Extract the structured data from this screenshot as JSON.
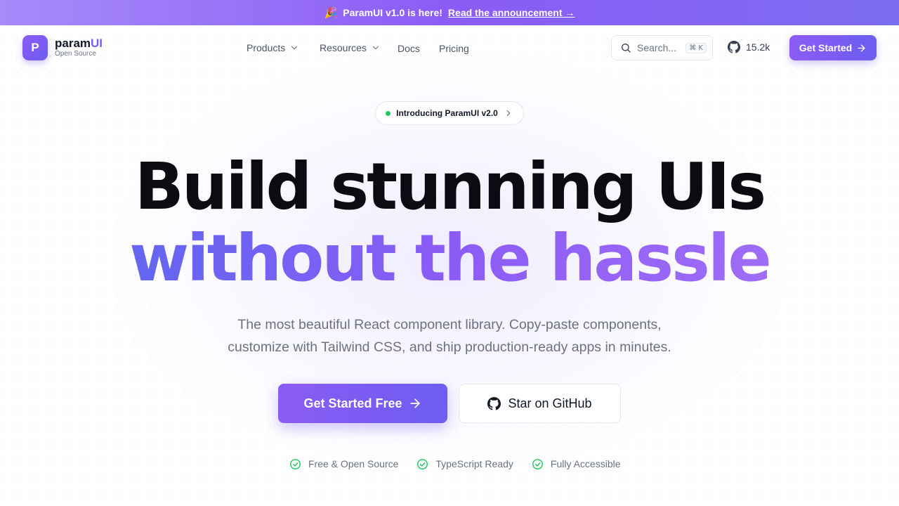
{
  "announcement": {
    "emoji": "🎉",
    "text": "ParamUI v1.0 is here!",
    "link": "Read the announcement →"
  },
  "nav": {
    "logo_letter": "P",
    "brand_main": "param",
    "brand_accent": "UI",
    "brand_sub": "Open Source",
    "menu": [
      {
        "label": "Products",
        "has_dropdown": true
      },
      {
        "label": "Resources",
        "has_dropdown": true
      },
      {
        "label": "Docs",
        "has_dropdown": false
      },
      {
        "label": "Pricing",
        "has_dropdown": false
      }
    ],
    "search_placeholder": "Search...",
    "search_shortcut": "⌘ K",
    "github_stars": "15.2k",
    "cta": "Get Started"
  },
  "hero": {
    "badge": "Introducing ParamUI v2.0",
    "headline_line1": "Build stunning UIs",
    "headline_line2": "without the hassle",
    "subtext_line1": "The most beautiful React component library. Copy-paste components,",
    "subtext_line2": "customize with Tailwind CSS, and ship production-ready apps in minutes.",
    "cta_primary": "Get Started Free",
    "cta_secondary": "Star on GitHub",
    "features": [
      "Free & Open Source",
      "TypeScript Ready",
      "Fully Accessible"
    ]
  },
  "colors": {
    "accent": "#8b5cf6",
    "accent_dark": "#6d5df0",
    "success": "#22c55e"
  }
}
